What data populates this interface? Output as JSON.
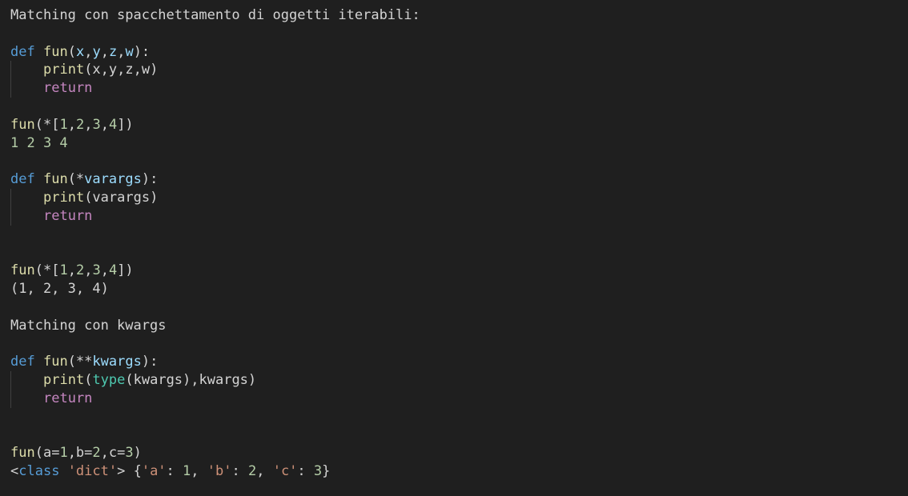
{
  "colors": {
    "background": "#1f1f1f",
    "text": "#d4d4d4",
    "keyword": "#569cd6",
    "function": "#dcdcaa",
    "parameter": "#9cdcfe",
    "control": "#c586c0",
    "builtin": "#4ec9b0",
    "number": "#b5cea8",
    "string": "#ce9178",
    "indent_guide": "#404040"
  },
  "doc": {
    "heading1": "Matching con spacchettamento di oggetti iterabili:",
    "heading2": "Matching con kwargs",
    "output1": "1 2 3 4",
    "output2": "(1, 2, 3, 4)",
    "output3": {
      "lt": "<",
      "cls": "class",
      "sp": " ",
      "dict": "'dict'",
      "gt": "> {",
      "ka": "'a'",
      "s1": ": ",
      "v1": "1",
      "c1": ", ",
      "kb": "'b'",
      "s2": ": ",
      "v2": "2",
      "c2": ", ",
      "kc": "'c'",
      "s3": ": ",
      "v3": "3",
      "end": "}"
    }
  },
  "code": {
    "block1": {
      "def": "def",
      "sp": " ",
      "fun": "fun",
      "lpar": "(",
      "p1": "x",
      "c1": ",",
      "p2": "y",
      "c2": ",",
      "p3": "z",
      "c3": ",",
      "p4": "w",
      "rpar": "):",
      "print": "print",
      "args": "(x,y,z,w)",
      "ret": "return"
    },
    "call1": {
      "fun": "fun",
      "open": "(*[",
      "n1": "1",
      "c1": ",",
      "n2": "2",
      "c2": ",",
      "n3": "3",
      "c3": ",",
      "n4": "4",
      "close": "])"
    },
    "block2": {
      "def": "def",
      "sp": " ",
      "fun": "fun",
      "lpar": "(*",
      "param": "varargs",
      "rpar": "):",
      "print": "print",
      "args": "(varargs)",
      "ret": "return"
    },
    "call2": {
      "fun": "fun",
      "open": "(*[",
      "n1": "1",
      "c1": ",",
      "n2": "2",
      "c2": ",",
      "n3": "3",
      "c3": ",",
      "n4": "4",
      "close": "])"
    },
    "block3": {
      "def": "def",
      "sp": " ",
      "fun": "fun",
      "lpar": "(**",
      "param": "kwargs",
      "rpar": "):",
      "print": "print",
      "lp": "(",
      "type": "type",
      "args": "(kwargs),kwargs)",
      "ret": "return"
    },
    "call3": {
      "fun": "fun",
      "a": "(a=",
      "n1": "1",
      "b": ",b=",
      "n2": "2",
      "c": ",c=",
      "n3": "3",
      "close": ")"
    }
  }
}
